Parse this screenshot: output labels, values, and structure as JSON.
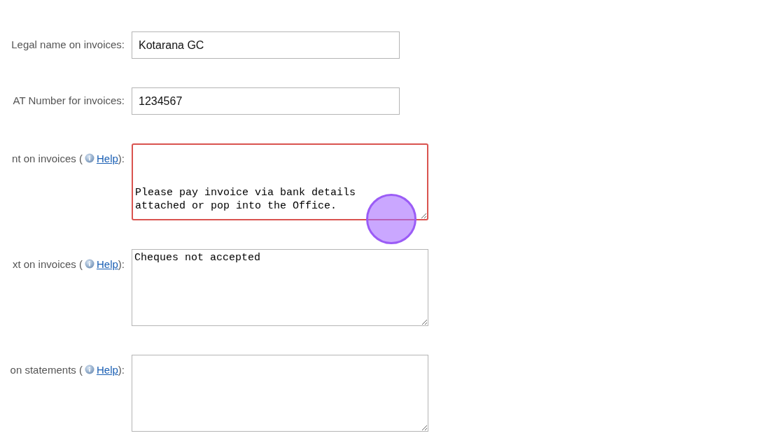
{
  "fields": [
    {
      "kind": "input",
      "label": "Legal name on invoices:",
      "value": "Kotarana GC",
      "invalid": false
    },
    {
      "kind": "input",
      "label": "AT Number for invoices:",
      "value": "1234567",
      "invalid": false
    },
    {
      "kind": "textarea",
      "label": "nt on invoices (",
      "help": "Help",
      "label_end": "):",
      "value": "\n\n\nPlease pay invoice via bank details\nattached or pop into the Office.",
      "invalid": true
    },
    {
      "kind": "textarea",
      "label": "xt on invoices (",
      "help": "Help",
      "label_end": "):",
      "value": "Cheques not accepted",
      "invalid": false
    },
    {
      "kind": "textarea",
      "label": "on statements (",
      "help": "Help",
      "label_end": "):",
      "invalid": false
    }
  ],
  "click_marker": true
}
